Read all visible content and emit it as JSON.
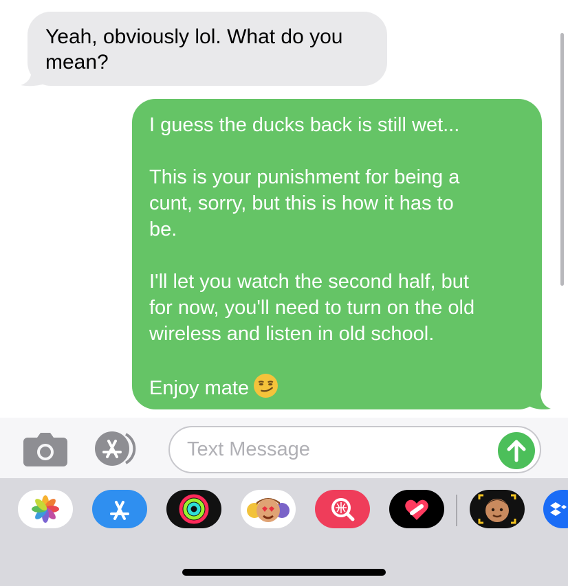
{
  "thread": {
    "incoming_message": "Yeah, obviously lol. What do you mean?",
    "outgoing_message": {
      "paragraphs": [
        "I guess the ducks back is still wet...",
        "This is your punishment for being a\ncunt, sorry, but this is how it has to\nbe.",
        "I'll let you watch the second half, but\nfor now, you'll need to turn on the old\nwireless and listen in old school.",
        "Enjoy mate"
      ],
      "emoji": "smirking-face"
    }
  },
  "compose": {
    "placeholder": "Text Message",
    "camera_icon": "camera-icon",
    "apps_icon": "app-store-icon",
    "send_icon": "arrow-up-icon"
  },
  "app_drawer": {
    "apps": [
      "photos-icon",
      "app-store-icon",
      "activity-icon",
      "memoji-stickers-icon",
      "images-search-icon",
      "digital-touch-icon",
      "memoji-icon",
      "dropbox-icon"
    ]
  },
  "colors": {
    "incoming_bubble": "#e9e9eb",
    "outgoing_bubble": "#65c466",
    "send_button": "#4cbf5a",
    "drawer_background": "#d9d9de"
  }
}
